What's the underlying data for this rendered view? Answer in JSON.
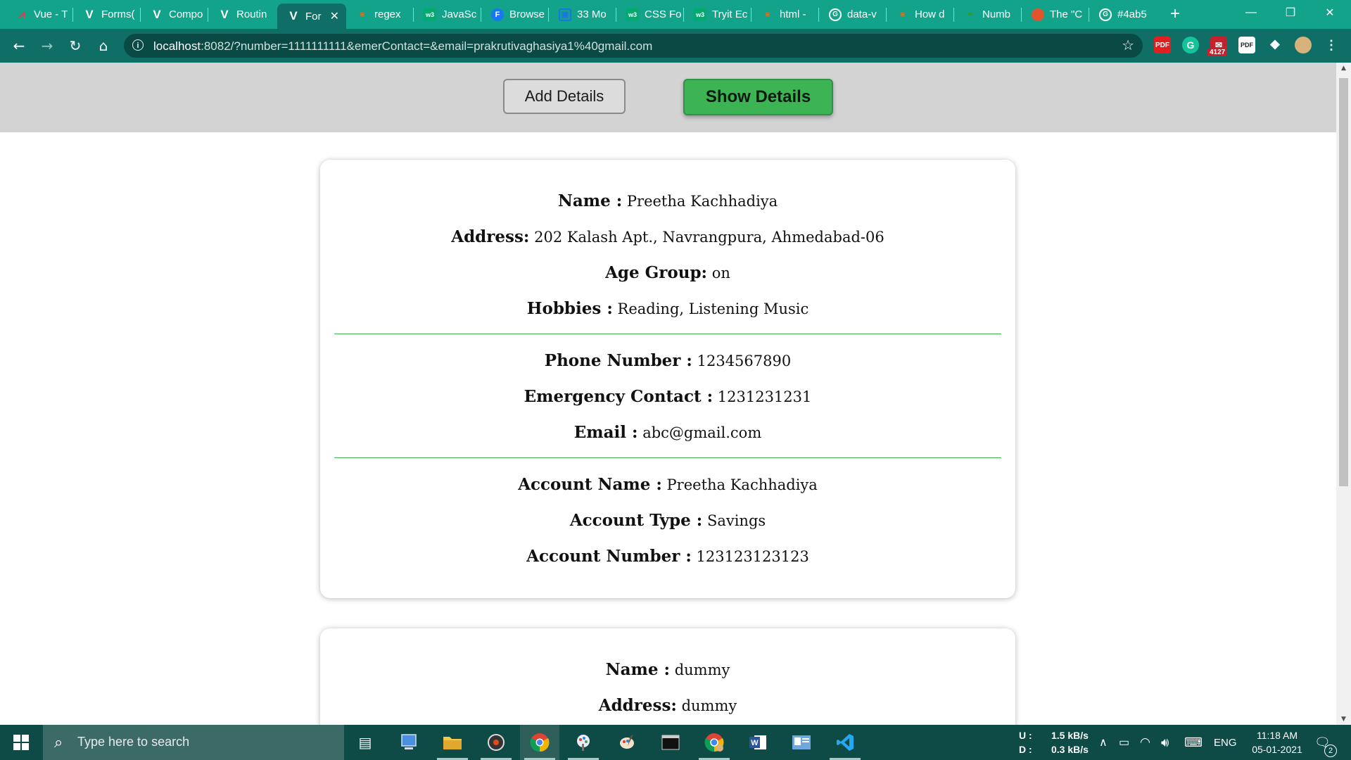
{
  "browser": {
    "tabs": [
      {
        "title": "Vue - T",
        "icon": "vue-logo-icon",
        "color": "#e8384f"
      },
      {
        "title": "Forms(",
        "icon": "vue-v-icon",
        "color": "#ffffff"
      },
      {
        "title": "Compo",
        "icon": "vue-v-icon",
        "color": "#ffffff"
      },
      {
        "title": "Routin",
        "icon": "vue-v-icon",
        "color": "#ffffff"
      },
      {
        "title": "For",
        "icon": "vue-v-icon",
        "color": "#ffffff",
        "active": true
      },
      {
        "title": "regex",
        "icon": "stackoverflow-icon",
        "color": "#f48024"
      },
      {
        "title": "JavaSc",
        "icon": "w3schools-icon",
        "color": "#04aa6d"
      },
      {
        "title": "Browse",
        "icon": "f-badge-icon",
        "color": "#1877f2"
      },
      {
        "title": "33 Mo",
        "icon": "bookmark-icon",
        "color": "#1a73e8"
      },
      {
        "title": "CSS Fo",
        "icon": "w3schools-icon",
        "color": "#04aa6d"
      },
      {
        "title": "Tryit Ec",
        "icon": "w3schools-icon",
        "color": "#04aa6d"
      },
      {
        "title": "html -",
        "icon": "stackoverflow-icon",
        "color": "#f48024"
      },
      {
        "title": "data-v",
        "icon": "google-g-icon",
        "color": "#ffffff"
      },
      {
        "title": "How d",
        "icon": "stackoverflow-icon",
        "color": "#f48024"
      },
      {
        "title": "Numb",
        "icon": "green-leaf-icon",
        "color": "#2e9c3a"
      },
      {
        "title": "The \"C",
        "icon": "colorful-circle-icon",
        "color": "#e2542c"
      },
      {
        "title": "#4ab5",
        "icon": "google-g-icon",
        "color": "#ffffff"
      }
    ],
    "address": {
      "host": "localhost",
      "rest": ":8082/?number=1111111111&emerContact=&email=prakrutivaghasiya1%40gmail.com"
    },
    "extension_badge": "4127"
  },
  "page": {
    "add_button": "Add Details",
    "show_button": "Show Details",
    "records": [
      {
        "name_label": "Name :",
        "name": "Preetha Kachhadiya",
        "address_label": "Address:",
        "address": "202 Kalash Apt., Navrangpura, Ahmedabad-06",
        "age_label": "Age Group:",
        "age": "on",
        "hobbies_label": "Hobbies :",
        "hobbies": "Reading, Listening Music",
        "phone_label": "Phone Number :",
        "phone": "1234567890",
        "emergency_label": "Emergency Contact :",
        "emergency": "1231231231",
        "email_label": "Email :",
        "email": "abc@gmail.com",
        "account_name_label": "Account Name :",
        "account_name": "Preetha Kachhadiya",
        "account_type_label": "Account Type :",
        "account_type": "Savings",
        "account_number_label": "Account Number :",
        "account_number": "123123123123"
      },
      {
        "name_label": "Name :",
        "name": "dummy",
        "address_label": "Address:",
        "address": "dummy"
      }
    ]
  },
  "taskbar": {
    "search_placeholder": "Type here to search",
    "net_up_label": "U :",
    "net_up": "1.5 kB/s",
    "net_down_label": "D :",
    "net_down": "0.3 kB/s",
    "language": "ENG",
    "time": "11:18 AM",
    "date": "05-01-2021",
    "notification_count": "2"
  },
  "colors": {
    "tab_strip": "#13a38a",
    "toolbar": "#0f6f67",
    "accent_green": "#3cb454",
    "page_header": "#d3d3d3"
  }
}
